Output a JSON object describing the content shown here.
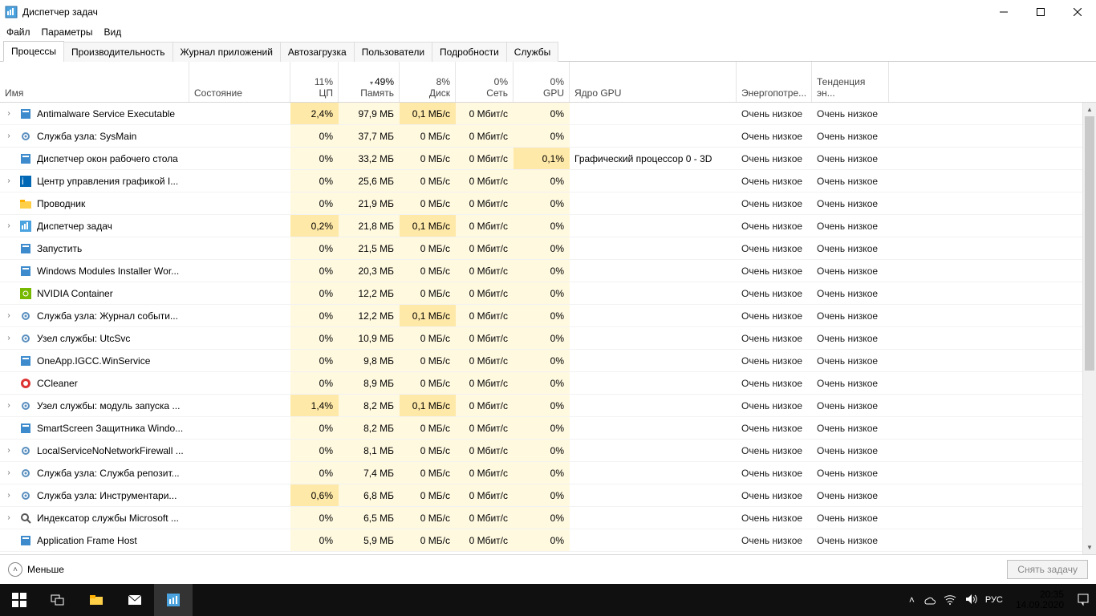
{
  "window": {
    "title": "Диспетчер задач"
  },
  "menu": {
    "file": "Файл",
    "options": "Параметры",
    "view": "Вид"
  },
  "tabs": {
    "items": [
      {
        "label": "Процессы",
        "active": true
      },
      {
        "label": "Производительность",
        "active": false
      },
      {
        "label": "Журнал приложений",
        "active": false
      },
      {
        "label": "Автозагрузка",
        "active": false
      },
      {
        "label": "Пользователи",
        "active": false
      },
      {
        "label": "Подробности",
        "active": false
      },
      {
        "label": "Службы",
        "active": false
      }
    ]
  },
  "columns": {
    "name": "Имя",
    "state": "Состояние",
    "cpu": {
      "top": "11%",
      "bot": "ЦП"
    },
    "mem": {
      "top": "49%",
      "bot": "Память"
    },
    "disk": {
      "top": "8%",
      "bot": "Диск"
    },
    "net": {
      "top": "0%",
      "bot": "Сеть"
    },
    "gpu": {
      "top": "0%",
      "bot": "GPU"
    },
    "gpucore": "Ядро GPU",
    "power": "Энергопотре...",
    "trend": "Тенденция эн..."
  },
  "power_label": "Очень низкое",
  "rows": [
    {
      "exp": true,
      "icon": "app-blue",
      "name": "Antimalware Service Executable",
      "cpu": "2,4%",
      "cpu_hot": true,
      "mem": "97,9 МБ",
      "disk": "0,1 МБ/с",
      "disk_hot": true,
      "net": "0 Мбит/с",
      "gpu": "0%",
      "gpucore": "",
      "power": "Очень низкое",
      "trend": "Очень низкое"
    },
    {
      "exp": true,
      "icon": "gear",
      "name": "Служба узла: SysMain",
      "cpu": "0%",
      "mem": "37,7 МБ",
      "disk": "0 МБ/с",
      "net": "0 Мбит/с",
      "gpu": "0%",
      "gpucore": "",
      "power": "Очень низкое",
      "trend": "Очень низкое"
    },
    {
      "exp": false,
      "icon": "app-blue",
      "name": "Диспетчер окон рабочего стола",
      "cpu": "0%",
      "mem": "33,2 МБ",
      "disk": "0 МБ/с",
      "net": "0 Мбит/с",
      "gpu": "0,1%",
      "gpu_hot": true,
      "gpucore": "Графический процессор 0 - 3D",
      "power": "Очень низкое",
      "trend": "Очень низкое"
    },
    {
      "exp": true,
      "icon": "intel",
      "name": "Центр управления графикой I...",
      "cpu": "0%",
      "mem": "25,6 МБ",
      "disk": "0 МБ/с",
      "net": "0 Мбит/с",
      "gpu": "0%",
      "gpucore": "",
      "power": "Очень низкое",
      "trend": "Очень низкое"
    },
    {
      "exp": false,
      "icon": "folder",
      "name": "Проводник",
      "cpu": "0%",
      "mem": "21,9 МБ",
      "disk": "0 МБ/с",
      "net": "0 Мбит/с",
      "gpu": "0%",
      "gpucore": "",
      "power": "Очень низкое",
      "trend": "Очень низкое"
    },
    {
      "exp": true,
      "icon": "taskmgr",
      "name": "Диспетчер задач",
      "cpu": "0,2%",
      "cpu_hot": true,
      "mem": "21,8 МБ",
      "disk": "0,1 МБ/с",
      "disk_hot": true,
      "net": "0 Мбит/с",
      "gpu": "0%",
      "gpucore": "",
      "power": "Очень низкое",
      "trend": "Очень низкое"
    },
    {
      "exp": false,
      "icon": "app-blue",
      "name": "Запустить",
      "cpu": "0%",
      "mem": "21,5 МБ",
      "disk": "0 МБ/с",
      "net": "0 Мбит/с",
      "gpu": "0%",
      "gpucore": "",
      "power": "Очень низкое",
      "trend": "Очень низкое"
    },
    {
      "exp": false,
      "icon": "app-blue",
      "name": "Windows Modules Installer Wor...",
      "cpu": "0%",
      "mem": "20,3 МБ",
      "disk": "0 МБ/с",
      "net": "0 Мбит/с",
      "gpu": "0%",
      "gpucore": "",
      "power": "Очень низкое",
      "trend": "Очень низкое"
    },
    {
      "exp": false,
      "icon": "nvidia",
      "name": "NVIDIA Container",
      "cpu": "0%",
      "mem": "12,2 МБ",
      "disk": "0 МБ/с",
      "net": "0 Мбит/с",
      "gpu": "0%",
      "gpucore": "",
      "power": "Очень низкое",
      "trend": "Очень низкое"
    },
    {
      "exp": true,
      "icon": "gear",
      "name": "Служба узла: Журнал событи...",
      "cpu": "0%",
      "mem": "12,2 МБ",
      "disk": "0,1 МБ/с",
      "disk_hot": true,
      "net": "0 Мбит/с",
      "gpu": "0%",
      "gpucore": "",
      "power": "Очень низкое",
      "trend": "Очень низкое"
    },
    {
      "exp": true,
      "icon": "gear",
      "name": "Узел службы: UtcSvc",
      "cpu": "0%",
      "mem": "10,9 МБ",
      "disk": "0 МБ/с",
      "net": "0 Мбит/с",
      "gpu": "0%",
      "gpucore": "",
      "power": "Очень низкое",
      "trend": "Очень низкое"
    },
    {
      "exp": false,
      "icon": "app-blue",
      "name": "OneApp.IGCC.WinService",
      "cpu": "0%",
      "mem": "9,8 МБ",
      "disk": "0 МБ/с",
      "net": "0 Мбит/с",
      "gpu": "0%",
      "gpucore": "",
      "power": "Очень низкое",
      "trend": "Очень низкое"
    },
    {
      "exp": false,
      "icon": "ccleaner",
      "name": "CCleaner",
      "cpu": "0%",
      "mem": "8,9 МБ",
      "disk": "0 МБ/с",
      "net": "0 Мбит/с",
      "gpu": "0%",
      "gpucore": "",
      "power": "Очень низкое",
      "trend": "Очень низкое"
    },
    {
      "exp": true,
      "icon": "gear",
      "name": "Узел службы: модуль запуска ...",
      "cpu": "1,4%",
      "cpu_hot": true,
      "mem": "8,2 МБ",
      "disk": "0,1 МБ/с",
      "disk_hot": true,
      "net": "0 Мбит/с",
      "gpu": "0%",
      "gpucore": "",
      "power": "Очень низкое",
      "trend": "Очень низкое"
    },
    {
      "exp": false,
      "icon": "app-blue",
      "name": "SmartScreen Защитника Windo...",
      "cpu": "0%",
      "mem": "8,2 МБ",
      "disk": "0 МБ/с",
      "net": "0 Мбит/с",
      "gpu": "0%",
      "gpucore": "",
      "power": "Очень низкое",
      "trend": "Очень низкое"
    },
    {
      "exp": true,
      "icon": "gear",
      "name": "LocalServiceNoNetworkFirewall ...",
      "cpu": "0%",
      "mem": "8,1 МБ",
      "disk": "0 МБ/с",
      "net": "0 Мбит/с",
      "gpu": "0%",
      "gpucore": "",
      "power": "Очень низкое",
      "trend": "Очень низкое"
    },
    {
      "exp": true,
      "icon": "gear",
      "name": "Служба узла: Служба репозит...",
      "cpu": "0%",
      "mem": "7,4 МБ",
      "disk": "0 МБ/с",
      "net": "0 Мбит/с",
      "gpu": "0%",
      "gpucore": "",
      "power": "Очень низкое",
      "trend": "Очень низкое"
    },
    {
      "exp": true,
      "icon": "gear",
      "name": "Служба узла: Инструментари...",
      "cpu": "0,6%",
      "cpu_hot": true,
      "mem": "6,8 МБ",
      "disk": "0 МБ/с",
      "net": "0 Мбит/с",
      "gpu": "0%",
      "gpucore": "",
      "power": "Очень низкое",
      "trend": "Очень низкое"
    },
    {
      "exp": true,
      "icon": "search",
      "name": "Индексатор службы Microsoft ...",
      "cpu": "0%",
      "mem": "6,5 МБ",
      "disk": "0 МБ/с",
      "net": "0 Мбит/с",
      "gpu": "0%",
      "gpucore": "",
      "power": "Очень низкое",
      "trend": "Очень низкое"
    },
    {
      "exp": false,
      "icon": "app-blue",
      "name": "Application Frame Host",
      "cpu": "0%",
      "mem": "5,9 МБ",
      "disk": "0 МБ/с",
      "net": "0 Мбит/с",
      "gpu": "0%",
      "gpucore": "",
      "power": "Очень низкое",
      "trend": "Очень низкое"
    }
  ],
  "footer": {
    "fewer": "Меньше",
    "end_task": "Снять задачу"
  },
  "tray": {
    "lang": "РУС",
    "time": "20:35",
    "date": "14.09.2020"
  }
}
